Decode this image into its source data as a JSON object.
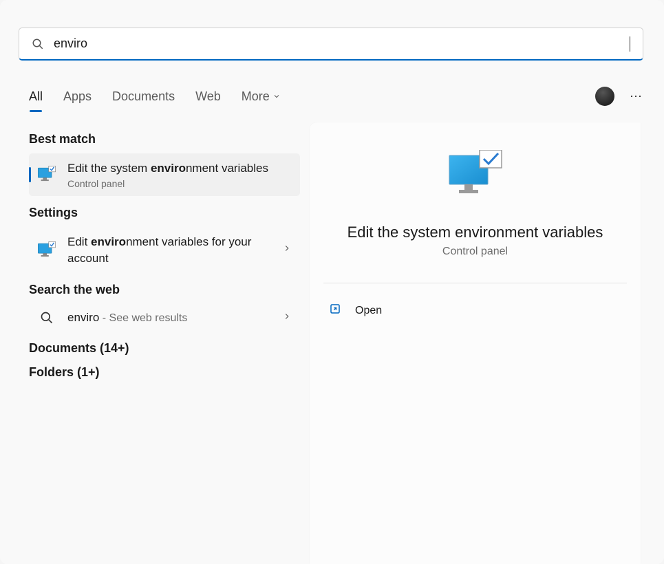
{
  "search": {
    "query": "enviro"
  },
  "tabs": {
    "all": "All",
    "apps": "Apps",
    "documents": "Documents",
    "web": "Web",
    "more": "More"
  },
  "sections": {
    "best_match": "Best match",
    "settings": "Settings",
    "search_web": "Search the web",
    "documents": "Documents (14+)",
    "folders": "Folders (1+)"
  },
  "results": {
    "best": {
      "title_pre": "Edit the system ",
      "title_bold": "enviro",
      "title_post": "nment variables",
      "subtitle": "Control panel"
    },
    "settings_item": {
      "title_pre": "Edit ",
      "title_bold": "enviro",
      "title_post": "nment variables for your account"
    },
    "web_item": {
      "term": "enviro",
      "suffix": " - See web results"
    }
  },
  "preview": {
    "title": "Edit the system environment variables",
    "subtitle": "Control panel",
    "open_label": "Open"
  }
}
